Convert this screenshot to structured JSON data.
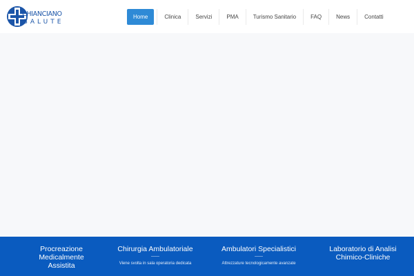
{
  "logo": {
    "line1": "CHIANCIANO",
    "line2": "SALUTE",
    "colors": {
      "brand": "#1b55a8"
    }
  },
  "nav": {
    "items": [
      {
        "label": "Home",
        "active": true
      },
      {
        "label": "Clinica",
        "active": false
      },
      {
        "label": "Servizi",
        "active": false
      },
      {
        "label": "PMA",
        "active": false
      },
      {
        "label": "Turismo Sanitario",
        "active": false
      },
      {
        "label": "FAQ",
        "active": false
      },
      {
        "label": "News",
        "active": false
      },
      {
        "label": "Contatti",
        "active": false
      }
    ],
    "colors": {
      "active_bg": "#2e8ad6"
    }
  },
  "services": {
    "colors": {
      "band_bg": "#0a5bbf"
    },
    "items": [
      {
        "title": "Procreazione Medicalmente Assistita",
        "description": ""
      },
      {
        "title": "Chirurgia Ambulatoriale",
        "description": "Viene svolta in sala operatoria dedicata"
      },
      {
        "title": "Ambulatori Specialistici",
        "description": "Attrezzature tecnologicamente avanzate"
      },
      {
        "title": "Laboratorio di Analisi Chimico-Cliniche",
        "description": ""
      }
    ]
  }
}
